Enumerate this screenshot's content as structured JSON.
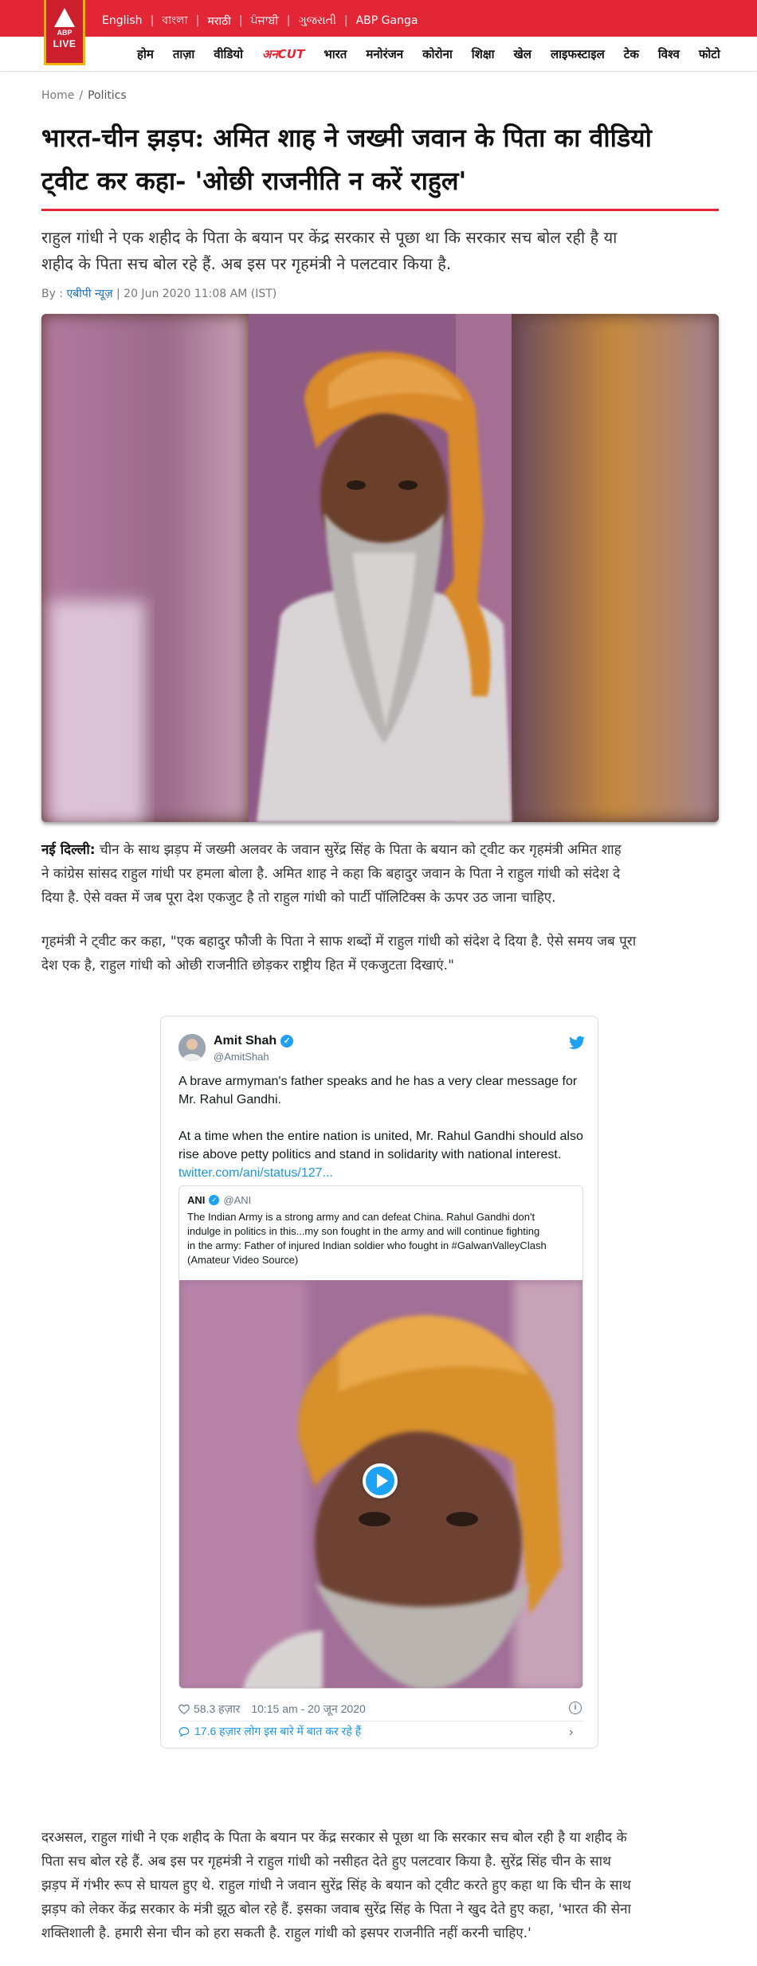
{
  "header": {
    "logo_top": "ABP",
    "logo_bottom": "LIVE",
    "languages": [
      "English",
      "বাংলা",
      "मराठी",
      "ਪੰਜਾਬੀ",
      "ગુજરાતી",
      "ABP Ganga"
    ]
  },
  "nav": {
    "items": [
      "होम",
      "ताज़ा",
      "वीडियो",
      "अनCUT",
      "भारत",
      "मनोरंजन",
      "कोरोना",
      "शिक्षा",
      "खेल",
      "लाइफस्टाइल",
      "टेक",
      "विश्व",
      "फोटो"
    ]
  },
  "breadcrumb": {
    "home": "Home",
    "separator": "/",
    "current": "Politics"
  },
  "article": {
    "title_line1": "भारत-चीन झड़प: अमित शाह ने जख्मी जवान के पिता का वीडियो",
    "title_line2": "ट्वीट कर कहा- 'ओछी राजनीति न करें राहुल'",
    "summary_line1": "राहुल गांधी ने एक शहीद के पिता के बयान पर केंद्र सरकार से पूछा था कि सरकार सच बोल रही है या",
    "summary_line2": "शहीद के पिता सच बोल रहे हैं. अब इस पर गृहमंत्री ने पलटवार किया है.",
    "by_label": "By :",
    "author": "एबीपी न्यूज़",
    "date": "20 Jun 2020 11:08 AM (IST)",
    "para1_lead": "नई दिल्ली:",
    "para1_l1": " चीन के साथ झड़प में जख्मी अलवर के जवान सुरेंद्र सिंह के पिता के बयान को ट्वीट कर गृहमंत्री अमित शाह",
    "para1_l2": "ने कांग्रेस सांसद राहुल गांधी पर हमला बोला है. अमित शाह ने कहा कि बहादुर जवान के पिता ने राहुल गांधी को संदेश दे",
    "para1_l3": "दिया है. ऐसे वक्त में जब पूरा देश एकजुट है तो राहुल गांधी को पार्टी पॉलिटिक्स के ऊपर उठ जाना चाहिए.",
    "para2_l1": "गृहमंत्री ने ट्वीट कर कहा, \"एक बहादुर फौजी के पिता ने साफ शब्दों में राहुल गांधी को संदेश दे दिया है. ऐसे समय जब पूरा",
    "para2_l2": "देश एक है, राहुल गांधी को ओछी राजनीति छोड़कर राष्ट्रीय हित में एकजुटता दिखाएं.\"",
    "para3_l1": "दरअसल, राहुल गांधी ने एक शहीद के पिता के बयान पर केंद्र सरकार से पूछा था कि सरकार सच बोल रही है या शहीद के",
    "para3_l2": "पिता सच बोल रहे हैं. अब इस पर गृहमंत्री ने राहुल गांधी को नसीहत देते हुए पलटवार किया है. सुरेंद्र सिंह चीन के साथ",
    "para3_l3": "झड़प में गंभीर रूप से घायल हुए थे. राहुल गांधी ने जवान सुरेंद्र सिंह के बयान को ट्वीट करते हुए कहा था कि चीन के साथ",
    "para3_l4": "झड़प को लेकर केंद्र सरकार के मंत्री झूठ बोल रहे हैं. इसका जवाब सुरेंद्र सिंह के पिता ने खुद देते हुए कहा, 'भारत की सेना",
    "para3_l5": "शक्तिशाली है. हमारी सेना चीन को हरा सकती है. राहुल गांधी को इसपर राजनीति नहीं करनी चाहिए.'"
  },
  "tweet": {
    "name": "Amit Shah",
    "verified_mark": "✓",
    "handle": "@AmitShah",
    "text_p1_l1": "A brave armyman's father speaks and he has a very clear message for",
    "text_p1_l2": "Mr. Rahul Gandhi.",
    "text_p2_l1": "At a time when the entire nation is united, Mr. Rahul Gandhi should also",
    "text_p2_l2": "rise above petty politics and stand in solidarity with national interest.",
    "link": "twitter.com/ani/status/127...",
    "quoted": {
      "name": "ANI",
      "verified_mark": "✓",
      "handle": "@ANI",
      "text_l1": "The Indian Army is a strong army and can defeat China. Rahul Gandhi don't",
      "text_l2": "indulge in politics in this...my son fought in the army and will continue fighting",
      "text_l3": "in the army: Father of injured Indian soldier who fought in #GalwanValleyClash",
      "text_l4": "(Amateur Video Source)"
    },
    "likes": "58.3 हज़ार",
    "time": "10:15 am - 20 जून 2020",
    "info_mark": "i",
    "conversation": "17.6 हज़ार लोग इस बारे में बात कर रहे हैं",
    "chevron": "›"
  },
  "colors": {
    "brand_red": "#e32636",
    "logo_gold": "#f2b600",
    "link_blue": "#1a6fb5",
    "twitter_blue": "#1da1f2"
  },
  "icons": [
    "abp-live-logo-icon",
    "twitter-bird-icon",
    "verified-icon",
    "play-icon",
    "heart-icon",
    "info-icon",
    "comment-icon",
    "chevron-right-icon"
  ]
}
